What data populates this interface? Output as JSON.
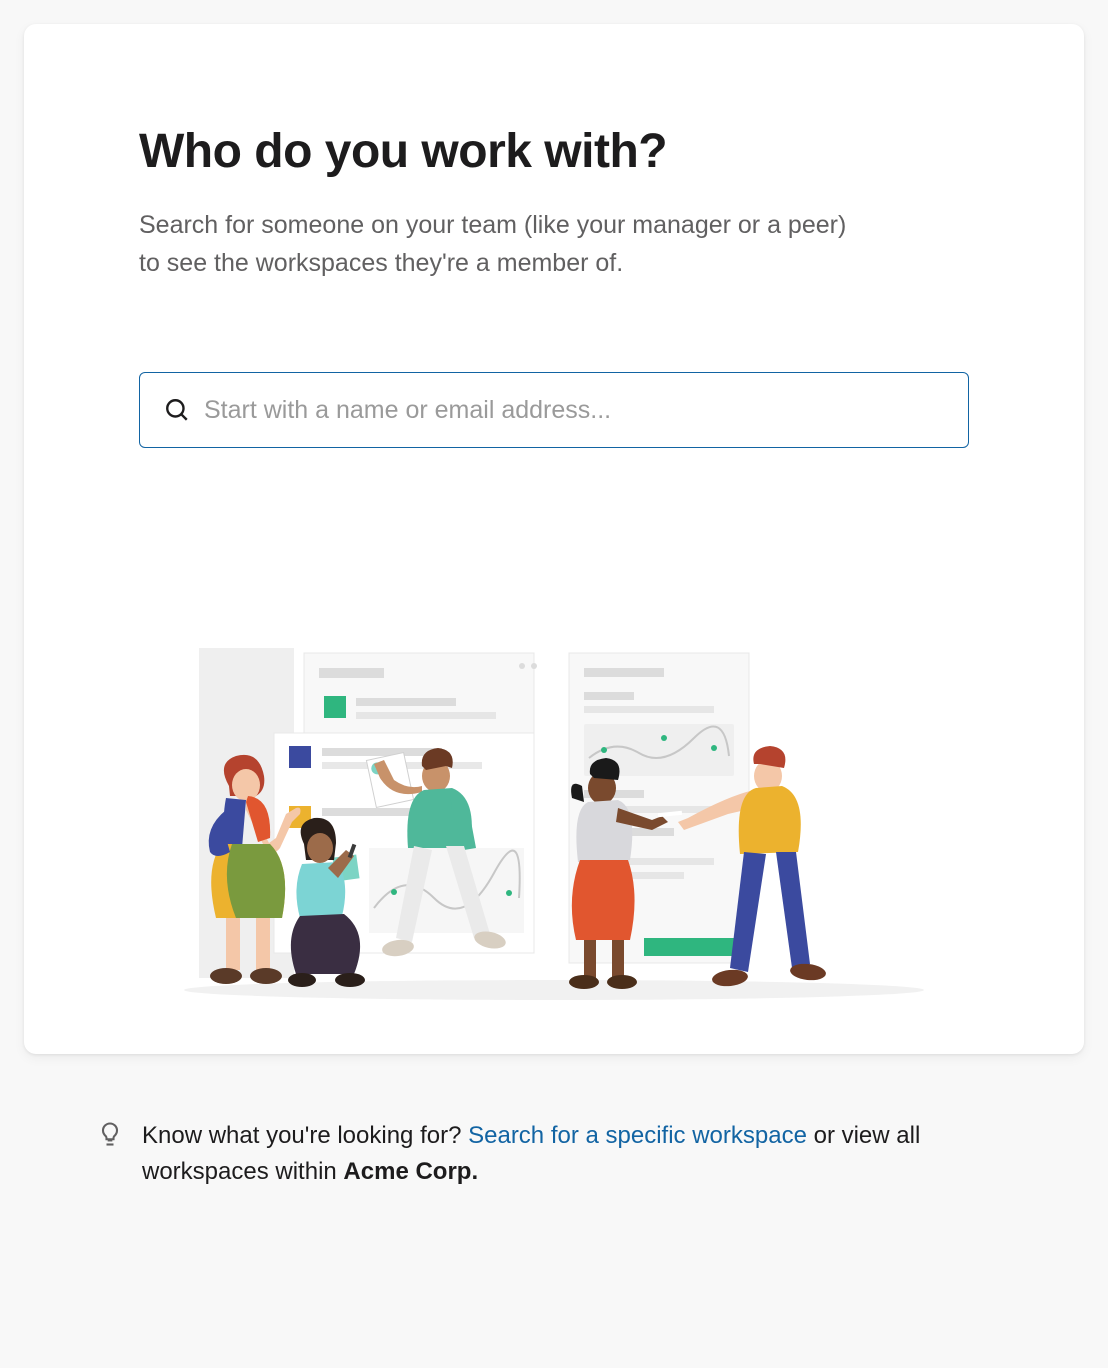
{
  "header": {
    "title": "Who do you work with?",
    "subtitle": "Search for someone on your team (like your manager or a peer) to see the workspaces they're a member of."
  },
  "search": {
    "placeholder": "Start with a name or email address...",
    "value": ""
  },
  "tip": {
    "prefix": "Know what you're looking for? ",
    "link_text": "Search for a specific workspace",
    "suffix_before_bold": " or view all workspaces within ",
    "org_name": "Acme Corp."
  },
  "colors": {
    "accent": "#1264a3",
    "text": "#1d1c1d",
    "muted": "#616061"
  }
}
